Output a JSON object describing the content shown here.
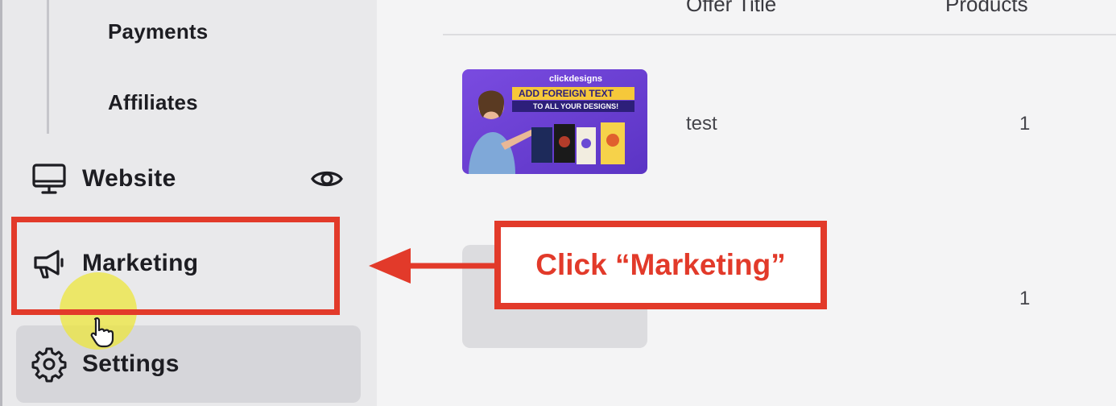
{
  "sidebar": {
    "sub_items": [
      {
        "label": "Payments"
      },
      {
        "label": "Affiliates"
      }
    ],
    "items": [
      {
        "label": "Website",
        "icon": "monitor-icon",
        "trailing_icon": "eye-icon"
      },
      {
        "label": "Marketing",
        "icon": "megaphone-icon"
      },
      {
        "label": "Settings",
        "icon": "gear-icon"
      }
    ]
  },
  "table": {
    "columns": [
      "Offer Title",
      "Products"
    ],
    "rows": [
      {
        "title": "test",
        "products": "1",
        "thumb": {
          "brand": "clickdesigns",
          "headline": "ADD FOREIGN TEXT",
          "subline": "TO ALL YOUR DESIGNS!"
        }
      },
      {
        "title": "",
        "products": "1"
      }
    ]
  },
  "annotation": {
    "callout": "Click “Marketing”",
    "color": "#e23a2a"
  },
  "colors": {
    "accent_red": "#e23a2a",
    "highlight_yellow": "#ece63c",
    "thumb_purple": "#6e3fd6"
  }
}
